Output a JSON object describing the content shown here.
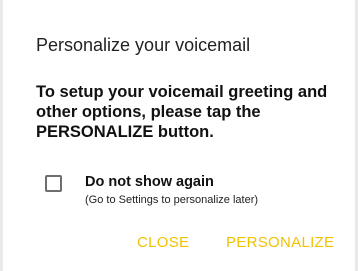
{
  "dialog": {
    "title": "Personalize your voicemail",
    "message": "To setup your voicemail greeting and other options, please tap the PERSONALIZE button.",
    "checkbox": {
      "label": "Do not show again",
      "sublabel": "(Go to Settings to personalize later)",
      "checked": false
    },
    "buttons": {
      "close": "CLOSE",
      "personalize": "PERSONALIZE"
    }
  },
  "colors": {
    "accent": "#f2c200",
    "background": "#ffffff",
    "text": "#111111"
  }
}
